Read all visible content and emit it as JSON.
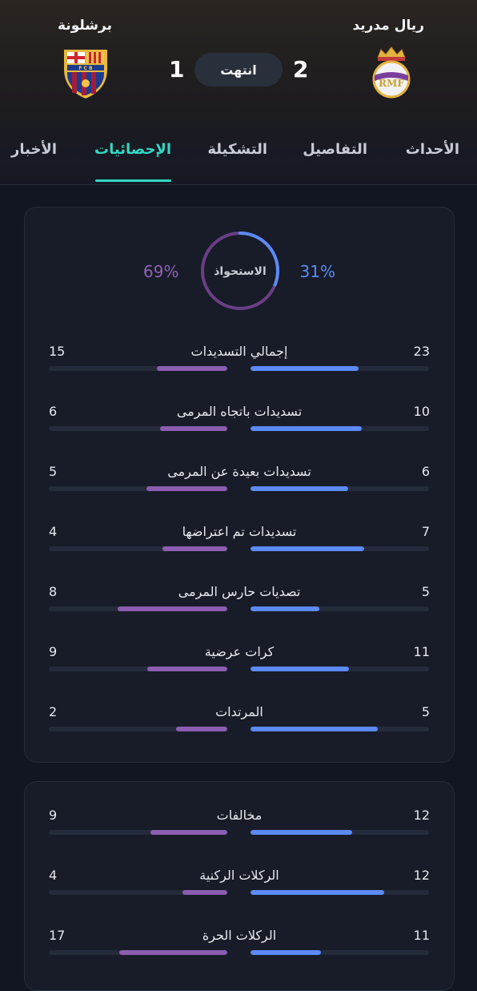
{
  "match": {
    "home_team": "ريال مدريد",
    "away_team": "برشلونة",
    "home_score": "2",
    "away_score": "1",
    "status": "انتهت"
  },
  "tabs": [
    {
      "label": "الأحداث",
      "active": false
    },
    {
      "label": "التفاصيل",
      "active": false
    },
    {
      "label": "التشكيلة",
      "active": false
    },
    {
      "label": "الإحصائيات",
      "active": true
    },
    {
      "label": "الأخبار",
      "active": false
    }
  ],
  "possession": {
    "label": "الاستحواذ",
    "home": "31%",
    "away": "69%",
    "home_fraction": 0.31
  },
  "stats_card1": [
    {
      "name": "إجمالي التسديدات",
      "home": 23,
      "away": 15
    },
    {
      "name": "تسديدات باتجاه المرمى",
      "home": 10,
      "away": 6
    },
    {
      "name": "تسديدات بعيدة عن المرمى",
      "home": 6,
      "away": 5
    },
    {
      "name": "تسديدات تم اعتراضها",
      "home": 7,
      "away": 4
    },
    {
      "name": "تصديات حارس المرمى",
      "home": 5,
      "away": 8
    },
    {
      "name": "كرات عرضية",
      "home": 11,
      "away": 9
    },
    {
      "name": "المرتدات",
      "home": 5,
      "away": 2
    }
  ],
  "stats_card2": [
    {
      "name": "مخالفات",
      "home": 12,
      "away": 9
    },
    {
      "name": "الركلات الركنية",
      "home": 12,
      "away": 4
    },
    {
      "name": "الركلات الحرة",
      "home": 11,
      "away": 17
    }
  ],
  "colors": {
    "home": "#5c8af6",
    "away": "#8c5db0",
    "accent": "#32d8c4"
  }
}
